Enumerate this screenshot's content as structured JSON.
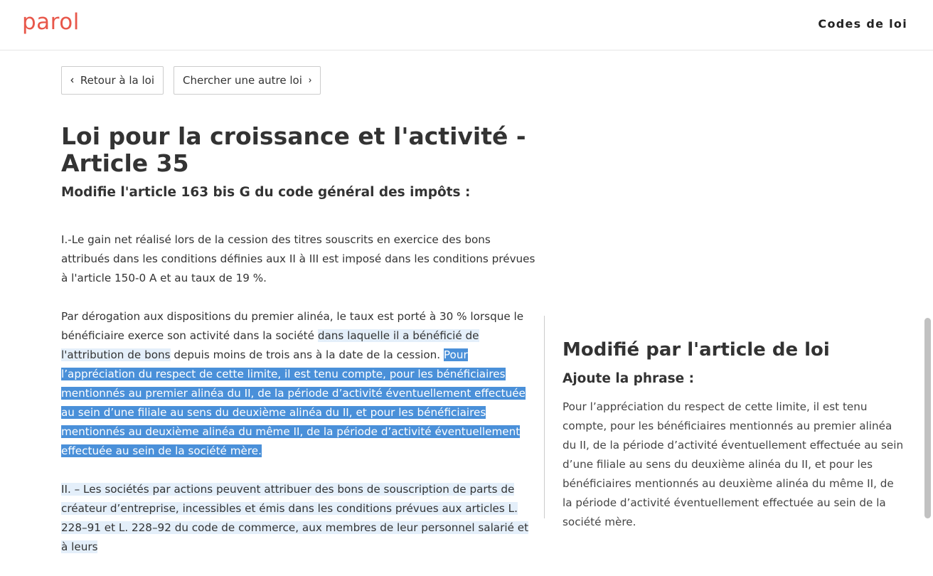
{
  "header": {
    "logo": "parol",
    "nav_link": "Codes de loi"
  },
  "buttons": {
    "back_label": "Retour à la loi",
    "search_label": "Chercher une autre loi"
  },
  "title": "Loi pour la croissance et l'activité - Article 35",
  "subtitle": "Modifie l'article 163 bis G du code général des impôts :",
  "article": {
    "p1": "I.-Le gain net réalisé lors de la cession des titres souscrits en exercice des bons attribués dans les conditions définies aux II à III est imposé dans les conditions prévues à l'article 150-0 A et au taux de 19 %.",
    "p2_start": "Par dérogation aux dispositions du premier alinéa, le taux est porté à 30 % lorsque le bénéficiaire exerce son activité dans la société ",
    "p2_hl1": "dans laquelle il a bénéficié de l'attribution de bons",
    "p2_mid": " depuis moins de trois ans à la date de la cession. ",
    "p2_hl2": "Pour l’appréciation du respect de cette limite, il est tenu compte, pour les bénéficiaires mentionnés au premier alinéa du II, de la période d’activité éventuellement effectuée au sein d’une filiale au sens du deuxième alinéa du II, et pour les bénéficiaires mentionnés au deuxième alinéa du même II, de la période d’activité éventuellement effectuée au sein de la société mère.",
    "p3": "II. – Les sociétés par actions peuvent attribuer des bons de souscription de parts de créateur d’entreprise, incessibles et émis dans les conditions prévues aux articles L. 228–91 et L. 228–92 du code de commerce, aux membres de leur personnel salarié et à leurs"
  },
  "side": {
    "title": "Modifié par l'article de loi",
    "subtitle": "Ajoute la phrase :",
    "text": "Pour l’appréciation du respect de cette limite, il est tenu compte, pour les bénéficiaires mentionnés au premier alinéa du II, de la période d’activité éventuellement effectuée au sein d’une filiale au sens du deuxième alinéa du II, et pour les bénéficiaires mentionnés au deuxième alinéa du même II, de la période d’activité éventuellement effectuée au sein de la société mère."
  },
  "colors": {
    "brand": "#e8574a",
    "highlight_light": "#e4effa",
    "highlight_dark": "#4a90d9"
  },
  "icons": {
    "back": "chevron-left-icon",
    "forward": "chevron-right-icon"
  }
}
